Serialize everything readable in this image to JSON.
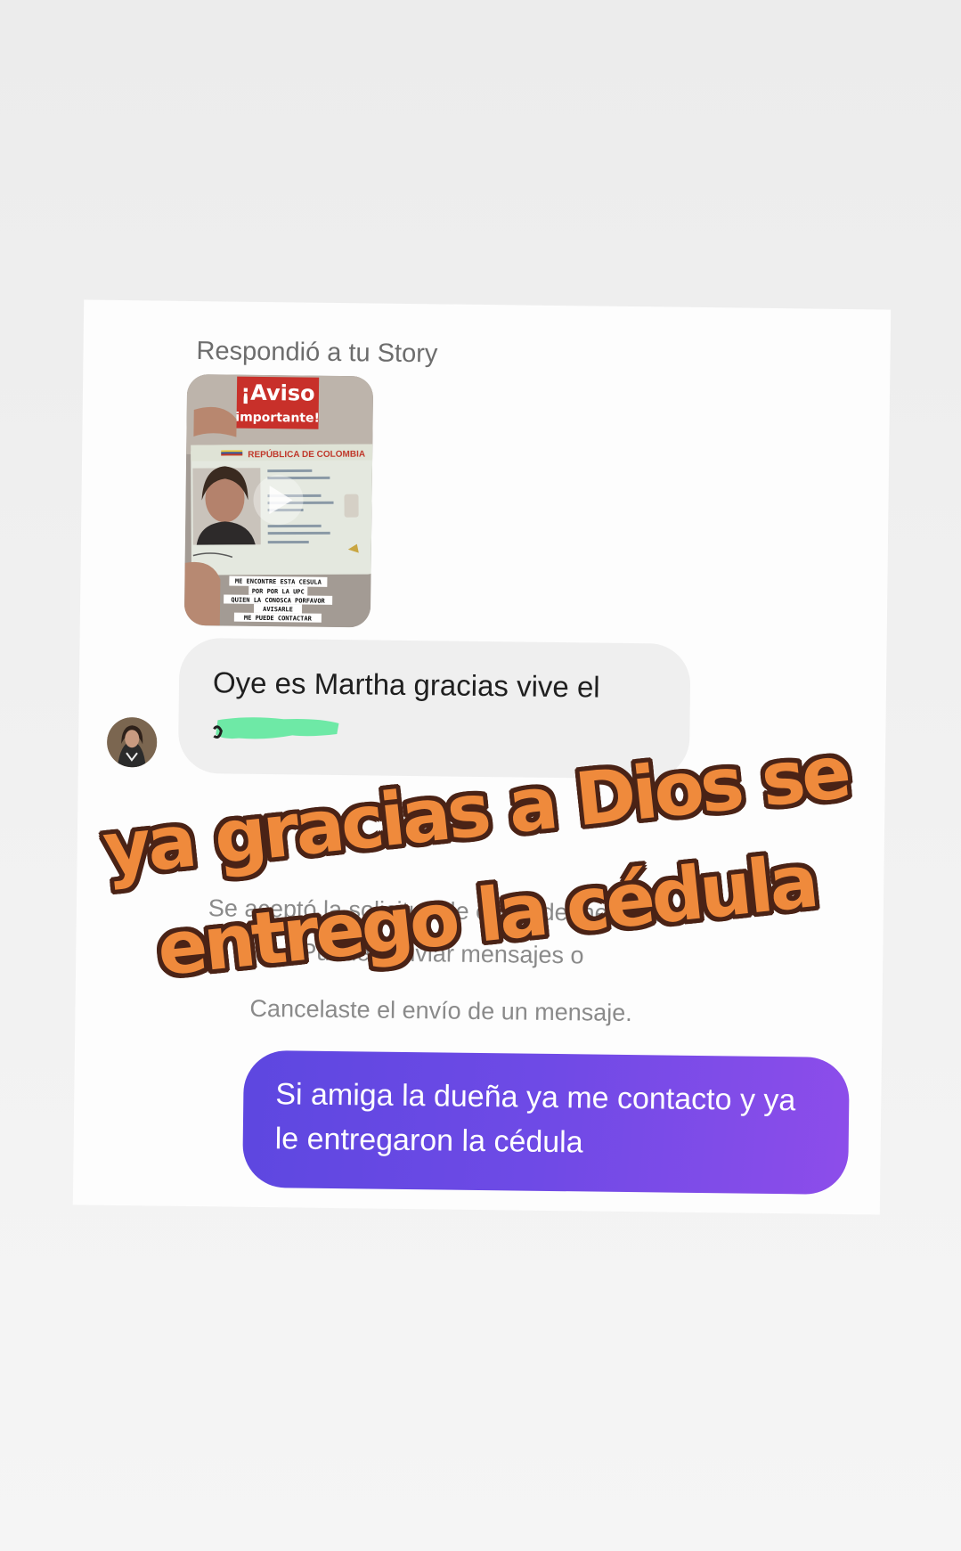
{
  "conversation": {
    "story_reply_label": "Respondió a tu Story",
    "story_preview": {
      "banner_line1": "¡Aviso",
      "banner_line2": "importante!",
      "id_card_header": "REPÚBLICA DE COLOMBIA",
      "caption_lines": [
        "ME ENCONTRE ESTA CESULA",
        "POR POR LA UPC",
        "QUIEN LA CONOSCA PORFAVOR",
        "AVISARLE",
        "ME PUEDE CONTACTAR"
      ]
    },
    "incoming_message": {
      "text": "Oye es Martha gracias vive el"
    },
    "status_lines": {
      "accepted": "Se aceptó la solicitud de envío de mensajes.",
      "can_send": "Puedes enviar mensajes o",
      "cancel": "Cancelaste el envío de un mensaje."
    },
    "outgoing_message": {
      "text": "Si amiga la dueña ya me contacto y ya le entregaron la cédula"
    }
  },
  "overlay_caption": {
    "line1": "ya gracias a Dios se",
    "line2": "entrego la cédula"
  },
  "colors": {
    "outgoing_bubble_start": "#5d47e0",
    "outgoing_bubble_end": "#8d4dea",
    "incoming_bubble": "#efefef",
    "overlay_text": "#ef8a3c",
    "overlay_outline": "#4a2316",
    "redaction_mark": "#6ee9a6",
    "story_banner": "#c8302a"
  }
}
